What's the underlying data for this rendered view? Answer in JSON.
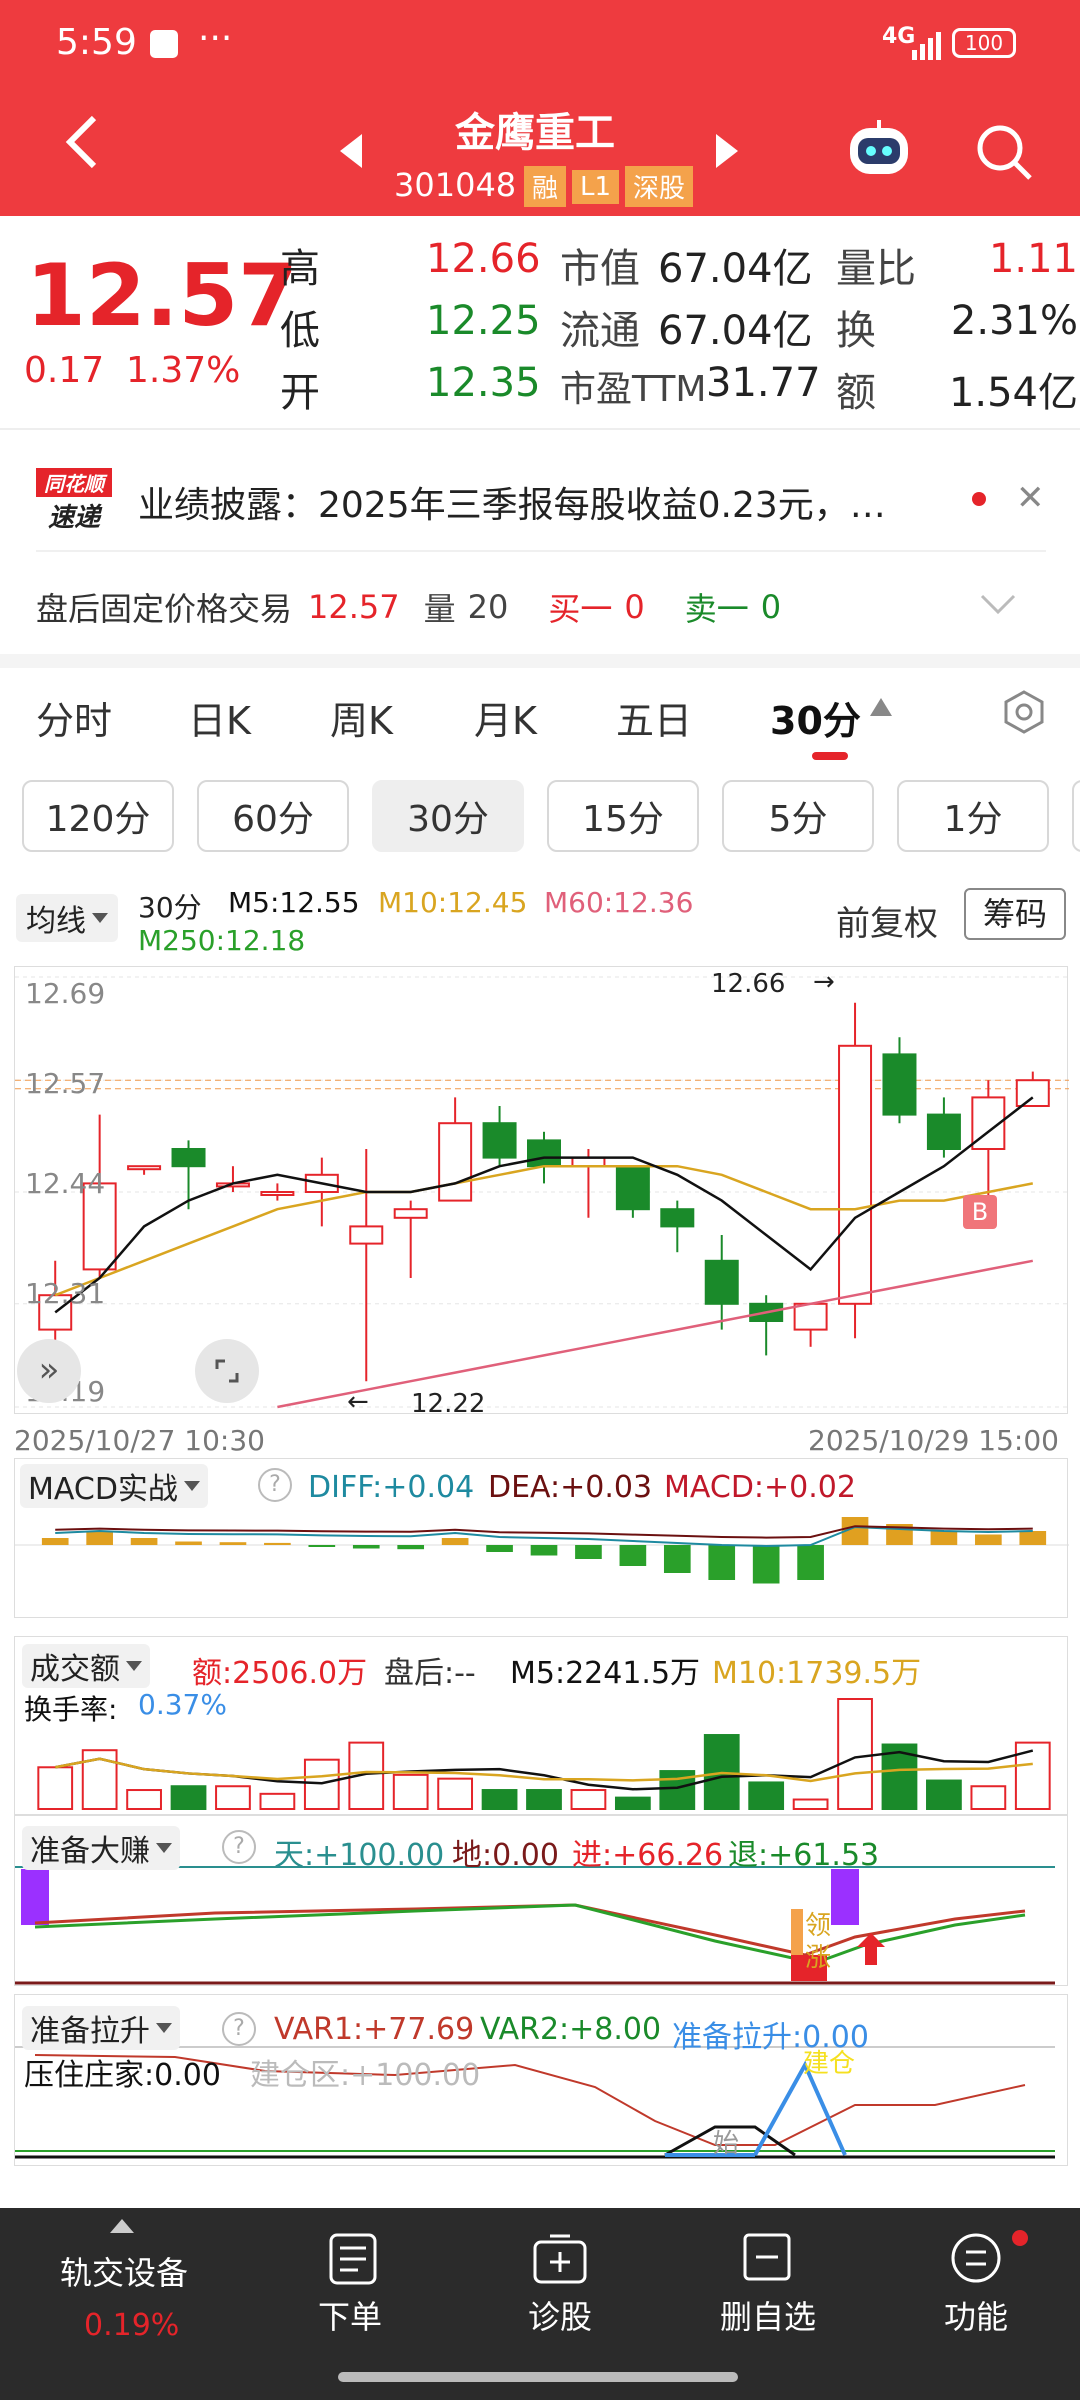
{
  "status_bar": {
    "time": "5:59",
    "network": "4G",
    "battery": "100"
  },
  "header": {
    "title": "金鹰重工",
    "code": "301048",
    "tags": [
      "融",
      "L1",
      "深股"
    ]
  },
  "quote": {
    "price": "12.57",
    "change": "0.17",
    "change_pct": "1.37%",
    "rows": [
      {
        "l1": "高",
        "v1": "12.66",
        "l2": "市值",
        "v2": "67.04亿",
        "l3": "量比",
        "v3": "1.11"
      },
      {
        "l1": "低",
        "v1": "12.25",
        "l2": "流通",
        "v2": "67.04亿",
        "l3": "换",
        "v3": "2.31%"
      },
      {
        "l1": "开",
        "v1": "12.35",
        "l2": "市盈TTM",
        "v2": "31.77",
        "l3": "额",
        "v3": "1.54亿"
      }
    ]
  },
  "news": {
    "logo_top": "同花顺",
    "logo_bottom": "速递",
    "text": "业绩披露：2025年三季报每股收益0.23元，…"
  },
  "after_hours": {
    "label": "盘后固定价格交易",
    "price": "12.57",
    "vol_label": "量",
    "vol": "20",
    "buy_label": "买一",
    "buy": "0",
    "sell_label": "卖一",
    "sell": "0"
  },
  "period_tabs": [
    "分时",
    "日K",
    "周K",
    "月K",
    "五日",
    "30分"
  ],
  "minute_tabs": [
    "120分",
    "60分",
    "30分",
    "15分",
    "5分",
    "1分"
  ],
  "ma_bar": {
    "selector": "均线",
    "period": "30分",
    "m5": "M5:12.55",
    "m10": "M10:12.45",
    "m60": "M60:12.36",
    "m250": "M250:12.18",
    "adjust": "前复权",
    "chips": "筹码"
  },
  "colors": {
    "up": "#e5242a",
    "down": "#1a8a2a",
    "header": "#ee3b3f",
    "ma5": "#111111",
    "ma10": "#d9a520",
    "ma60": "#e0607a"
  },
  "chart_data": {
    "type": "candlestick",
    "y_ticks": [
      "12.69",
      "12.57",
      "12.44",
      "12.31",
      "12.19"
    ],
    "ylim": [
      12.19,
      12.69
    ],
    "x_start": "2025/10/27 10:30",
    "x_end": "2025/10/29 15:00",
    "high_label": "12.66",
    "low_label": "12.22",
    "marker": "B",
    "candles": [
      {
        "o": 12.28,
        "h": 12.36,
        "l": 12.24,
        "c": 12.32
      },
      {
        "o": 12.35,
        "h": 12.53,
        "l": 12.34,
        "c": 12.45
      },
      {
        "o": 12.47,
        "h": 12.47,
        "l": 12.46,
        "c": 12.47
      },
      {
        "o": 12.49,
        "h": 12.5,
        "l": 12.42,
        "c": 12.47
      },
      {
        "o": 12.45,
        "h": 12.47,
        "l": 12.44,
        "c": 12.45
      },
      {
        "o": 12.44,
        "h": 12.45,
        "l": 12.43,
        "c": 12.44
      },
      {
        "o": 12.44,
        "h": 12.48,
        "l": 12.4,
        "c": 12.46
      },
      {
        "o": 12.38,
        "h": 12.49,
        "l": 12.22,
        "c": 12.4
      },
      {
        "o": 12.41,
        "h": 12.43,
        "l": 12.34,
        "c": 12.42
      },
      {
        "o": 12.43,
        "h": 12.55,
        "l": 12.43,
        "c": 12.52
      },
      {
        "o": 12.52,
        "h": 12.54,
        "l": 12.47,
        "c": 12.48
      },
      {
        "o": 12.5,
        "h": 12.51,
        "l": 12.45,
        "c": 12.47
      },
      {
        "o": 12.47,
        "h": 12.49,
        "l": 12.41,
        "c": 12.48
      },
      {
        "o": 12.47,
        "h": 12.47,
        "l": 12.41,
        "c": 12.42
      },
      {
        "o": 12.42,
        "h": 12.43,
        "l": 12.37,
        "c": 12.4
      },
      {
        "o": 12.36,
        "h": 12.39,
        "l": 12.28,
        "c": 12.31
      },
      {
        "o": 12.31,
        "h": 12.32,
        "l": 12.25,
        "c": 12.29
      },
      {
        "o": 12.28,
        "h": 12.31,
        "l": 12.26,
        "c": 12.31
      },
      {
        "o": 12.31,
        "h": 12.66,
        "l": 12.27,
        "c": 12.61
      },
      {
        "o": 12.6,
        "h": 12.62,
        "l": 12.52,
        "c": 12.53
      },
      {
        "o": 12.53,
        "h": 12.55,
        "l": 12.48,
        "c": 12.49
      },
      {
        "o": 12.49,
        "h": 12.57,
        "l": 12.43,
        "c": 12.55
      },
      {
        "o": 12.54,
        "h": 12.58,
        "l": 12.54,
        "c": 12.57
      }
    ],
    "ma5": [
      12.3,
      12.34,
      12.4,
      12.43,
      12.45,
      12.46,
      12.45,
      12.44,
      12.44,
      12.45,
      12.47,
      12.48,
      12.48,
      12.48,
      12.46,
      12.43,
      12.39,
      12.35,
      12.41,
      12.44,
      12.47,
      12.51,
      12.55
    ],
    "ma10": [
      12.32,
      12.34,
      12.36,
      12.38,
      12.4,
      12.42,
      12.43,
      12.44,
      12.44,
      12.45,
      12.46,
      12.47,
      12.47,
      12.47,
      12.47,
      12.46,
      12.44,
      12.42,
      12.42,
      12.43,
      12.43,
      12.44,
      12.45
    ],
    "ma60": [
      12.19,
      12.2,
      12.21,
      12.22,
      12.23,
      12.24,
      12.25,
      12.26,
      12.27,
      12.28,
      12.29,
      12.3,
      12.31,
      12.32,
      12.33,
      12.34,
      12.35,
      12.36
    ]
  },
  "macd": {
    "name": "MACD实战",
    "diff": "DIFF:+0.04",
    "dea": "DEA:+0.03",
    "macd": "MACD:+0.02",
    "bars": [
      0.01,
      0.02,
      0.01,
      0.005,
      0.004,
      0.003,
      -0.002,
      -0.005,
      -0.006,
      0.01,
      -0.01,
      -0.015,
      -0.02,
      -0.03,
      -0.04,
      -0.05,
      -0.055,
      -0.05,
      0.04,
      0.03,
      0.02,
      0.015,
      0.02
    ]
  },
  "volume": {
    "name": "成交额",
    "amount": "额:2506.0万",
    "after": "盘后:--",
    "m5": "M5:2241.5万",
    "m10": "M10:1739.5万",
    "turnover_label": "换手率:",
    "turnover": "0.37%",
    "bars": [
      2.2,
      3.1,
      1.0,
      1.2,
      1.2,
      0.8,
      2.6,
      3.5,
      1.8,
      1.6,
      1.0,
      1.0,
      1.0,
      0.6,
      2.0,
      3.9,
      1.4,
      0.5,
      5.8,
      3.4,
      1.5,
      1.2,
      3.5
    ]
  },
  "zbdz": {
    "name": "准备大赚",
    "tian": "天:+100.00",
    "di": "地:0.00",
    "jin": "进:+66.26",
    "tui": "退:+61.53",
    "ling": "领",
    "zhang": "涨"
  },
  "zbls": {
    "name": "准备拉升",
    "var1": "VAR1:+77.69",
    "var2": "VAR2:+8.00",
    "ls": "准备拉升:0.00",
    "yazhu": "压住庄家:0.00",
    "jiancang_area": "建仓区:+100.00",
    "jiancang": "建仓",
    "shi": "始"
  },
  "bottom_nav": [
    {
      "label": "轨交设备",
      "value": "0.19%"
    },
    {
      "label": "下单"
    },
    {
      "label": "诊股"
    },
    {
      "label": "删自选"
    },
    {
      "label": "功能"
    }
  ]
}
